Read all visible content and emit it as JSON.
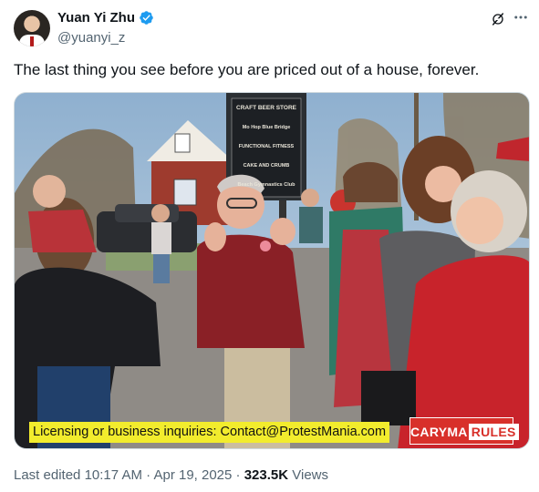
{
  "author": {
    "name": "Yuan Yi Zhu",
    "handle": "@yuanyi_z",
    "verified": true
  },
  "tweet": {
    "text": "The last thing you see before you are priced out of a house, forever."
  },
  "media": {
    "sign_lines": [
      "CRAFT BEER STORE",
      "Mo Hop Blue Bridge",
      "FUNCTIONAL FITNESS",
      "CAKE AND CRUMB",
      "Beach Gymnastics Club"
    ],
    "watermark_caption": "Licensing or business inquiries: Contact@ProtestMania.com",
    "brand_left": "CARYMA",
    "brand_right": "RULES"
  },
  "meta": {
    "edited_label": "Last edited",
    "time": "10:17 AM",
    "separator": "·",
    "date": "Apr 19, 2025",
    "views_count": "323.5K",
    "views_label": "Views"
  },
  "icons": {
    "verified": "verified-badge-icon",
    "grok": "grok-icon",
    "more": "more-options-icon"
  },
  "colors": {
    "verified_blue": "#1d9bf0",
    "text_primary": "#0f1419",
    "text_secondary": "#536471",
    "caption_yellow": "#f2ec2d",
    "brand_red": "#d8302a"
  }
}
